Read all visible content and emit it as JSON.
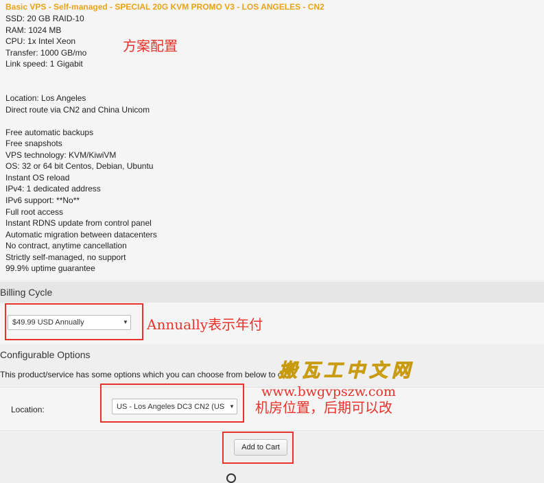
{
  "product": {
    "title": "Basic VPS - Self-managed - SPECIAL 20G KVM PROMO V3 - LOS ANGELES - CN2",
    "specs_group1": [
      "SSD: 20 GB RAID-10",
      "RAM: 1024 MB",
      "CPU: 1x Intel Xeon",
      "Transfer: 1000 GB/mo",
      "Link speed: 1 Gigabit"
    ],
    "specs_group2": [
      "Location: Los Angeles",
      "Direct route via CN2 and China Unicom"
    ],
    "specs_group3": [
      "Free automatic backups",
      "Free snapshots",
      "VPS technology: KVM/KiwiVM",
      "OS: 32 or 64 bit Centos, Debian, Ubuntu",
      "Instant OS reload",
      "IPv4: 1 dedicated address",
      "IPv6 support: **No**",
      "Full root access",
      "Instant RDNS update from control panel",
      "Automatic migration between datacenters",
      "No contract, anytime cancellation",
      "Strictly self-managed, no support",
      "99.9% uptime guarantee"
    ]
  },
  "billing": {
    "section_title": "Billing Cycle",
    "selected": "$49.99 USD Annually"
  },
  "config": {
    "section_title": "Configurable Options",
    "description": "This product/service has some options which you can choose from below to cu",
    "location_label": "Location:",
    "location_selected": "US - Los Angeles DC3 CN2 (US"
  },
  "cart": {
    "add_label": "Add to Cart"
  },
  "annotations": {
    "plan_config": "方案配置",
    "annually": "Annually表示年付",
    "location_note": "机房位置，后期可以改"
  },
  "watermark": {
    "text": "搬瓦工中文网",
    "url": "www.bwgvpszw.com"
  },
  "colors": {
    "title_orange": "#e8a317",
    "annotation_red": "#e8322a",
    "watermark_yellow": "#f0c020"
  }
}
